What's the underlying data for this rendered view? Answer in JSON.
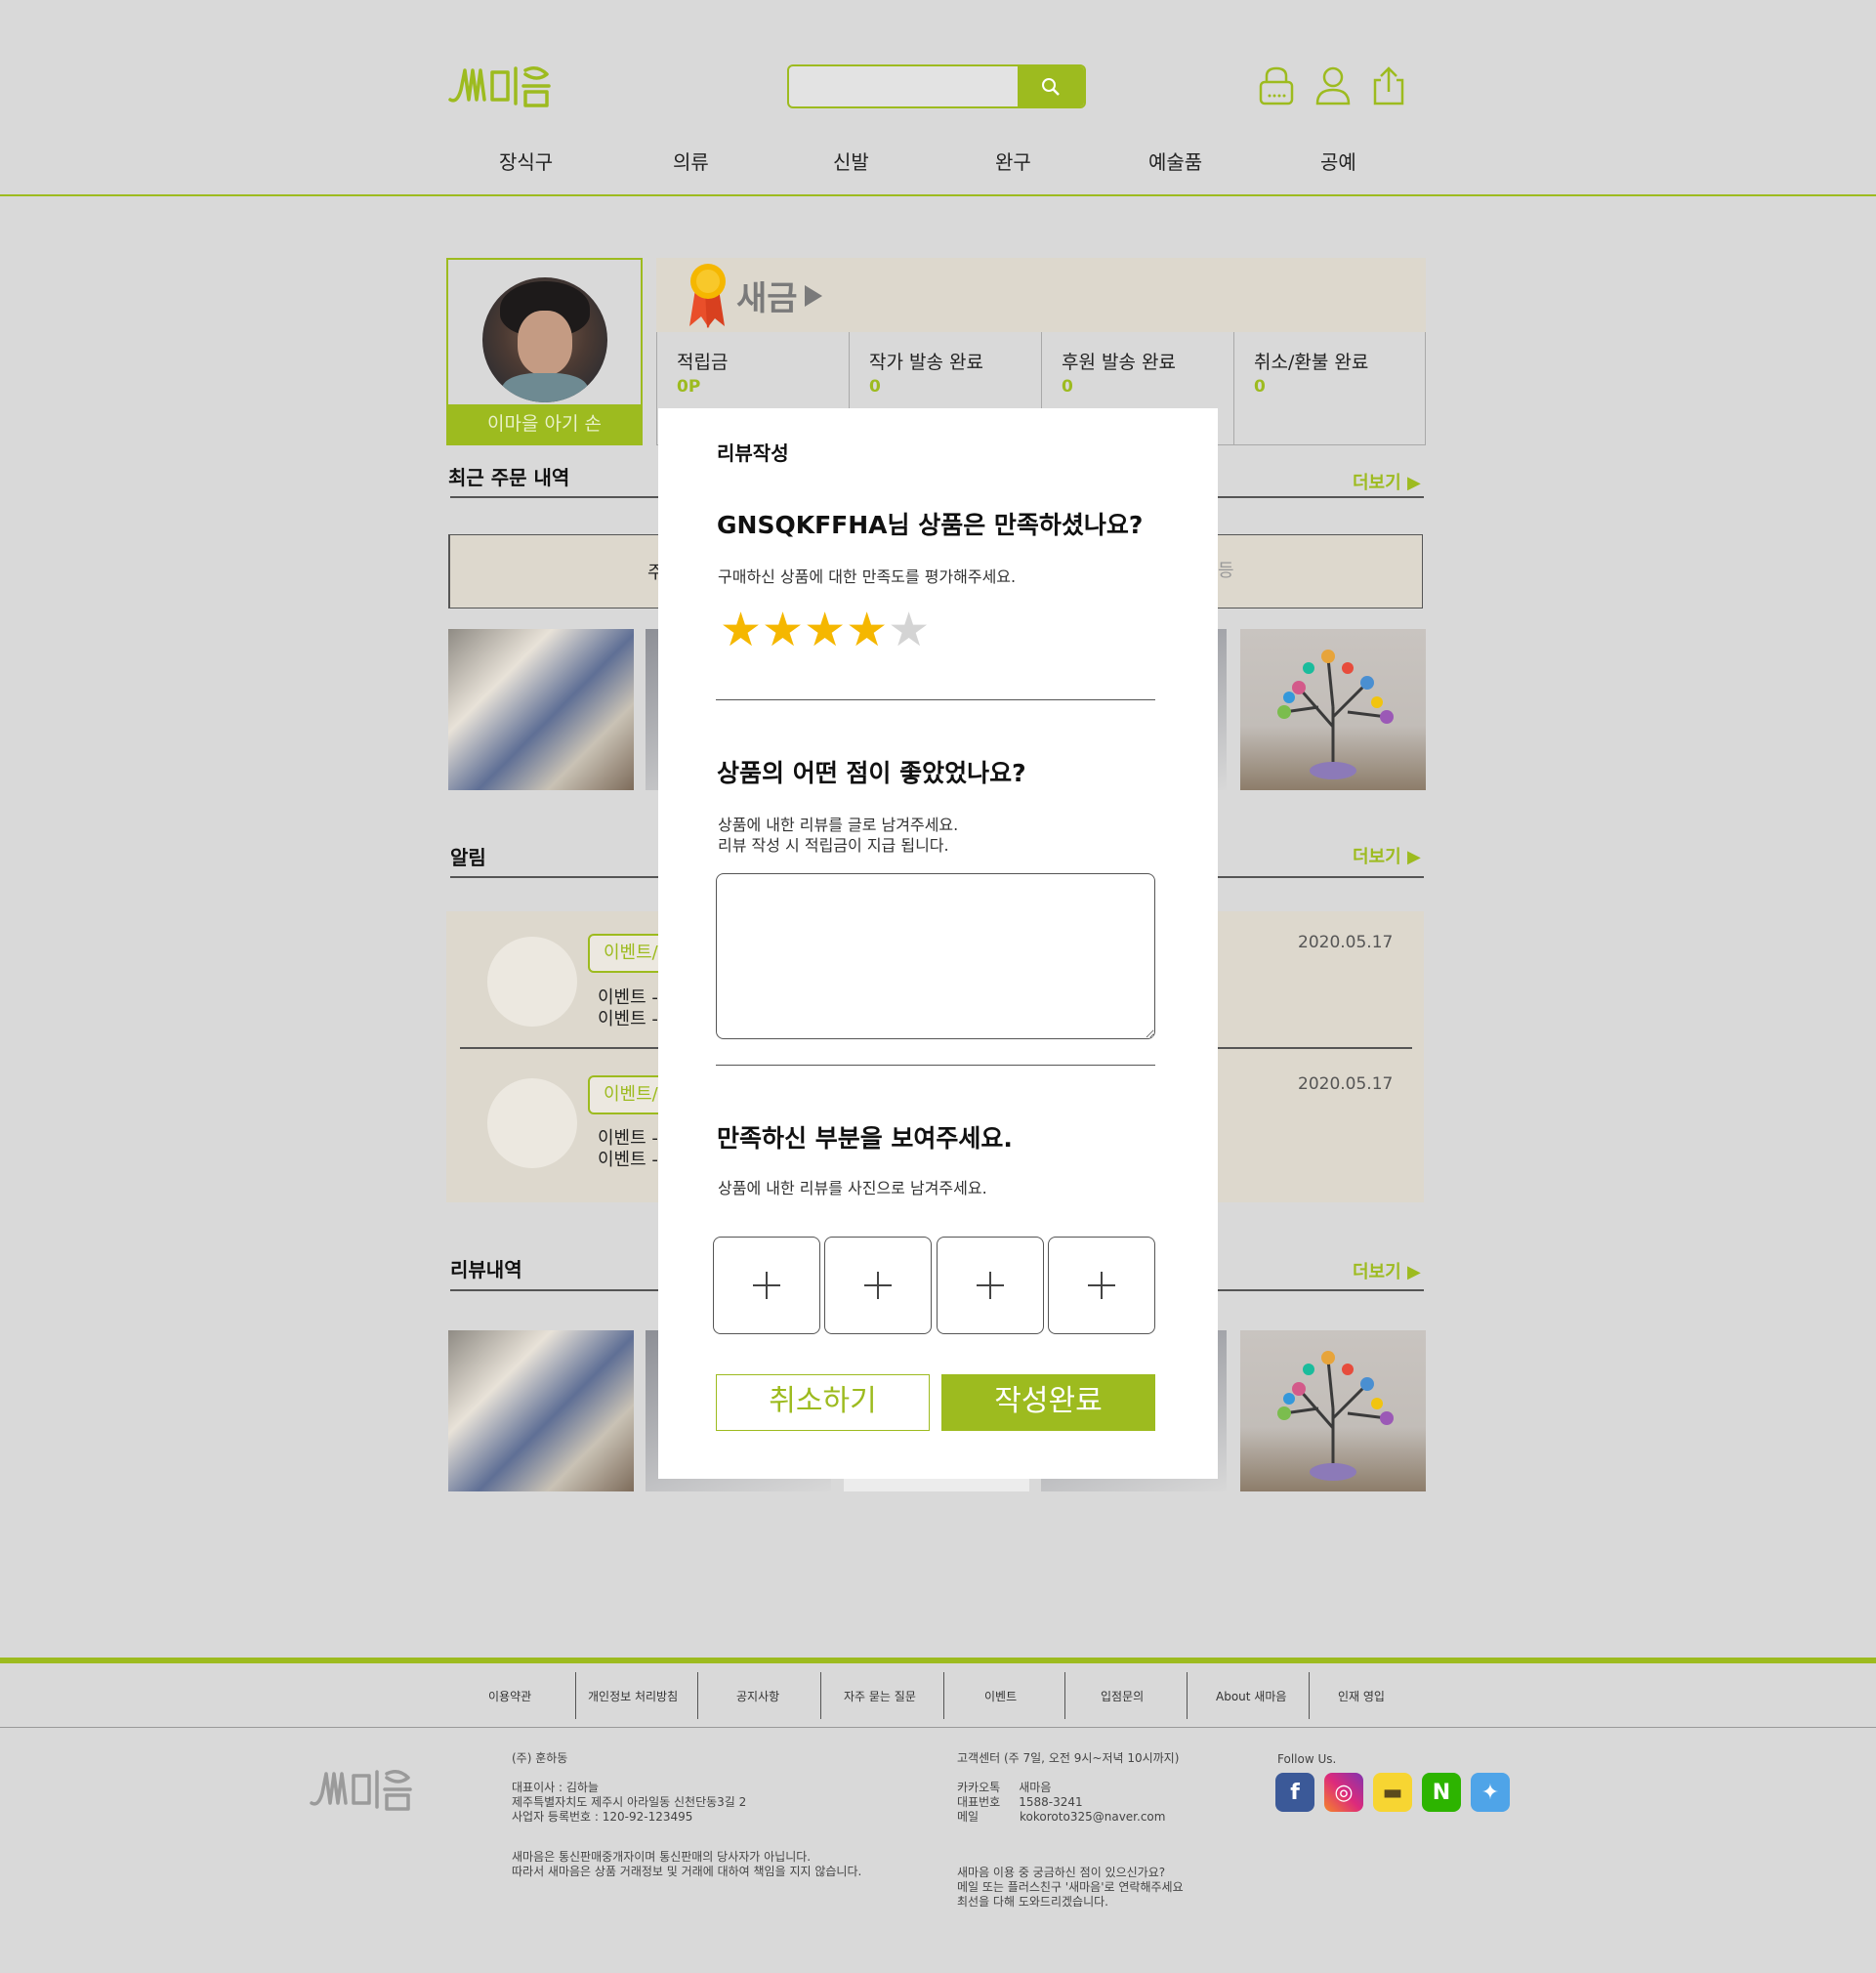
{
  "header": {
    "logo_text": "새마음",
    "search": {
      "placeholder": ""
    },
    "icons": [
      "lock-icon",
      "user-icon",
      "share-icon"
    ],
    "nav": [
      "장식구",
      "의류",
      "신발",
      "완구",
      "예술품",
      "공예"
    ]
  },
  "profile": {
    "name": "이마을 아기 손",
    "grade": "새금",
    "stats": [
      {
        "label": "적립금",
        "value": "0P"
      },
      {
        "label": "작가 발송 완료",
        "value": "0"
      },
      {
        "label": "후원 발송 완료",
        "value": "0"
      },
      {
        "label": "취소/환불 완료",
        "value": "0"
      }
    ]
  },
  "sections": {
    "recent_orders": {
      "title": "최근 주문 내역",
      "more": "더보기",
      "tab_partial_left": "주",
      "tab_partial_right": "등"
    },
    "notices": {
      "title": "알림",
      "more": "더보기",
      "items": [
        {
          "tag": "이벤트/",
          "line1": "이벤트 -",
          "line2": "이벤트 -",
          "date": "2020.05.17"
        },
        {
          "tag": "이벤트/",
          "line1": "이벤트 -",
          "line2": "이벤트 -",
          "date": "2020.05.17"
        }
      ]
    },
    "reviews": {
      "title": "리뷰내역",
      "more": "더보기"
    }
  },
  "modal": {
    "title": "리뷰작성",
    "q1": "GNSQKFFHA님 상품은 만족하셨나요?",
    "q1_desc": "구매하신 상품에 대한 만족도를 평가해주세요.",
    "rating": 4,
    "rating_max": 5,
    "q2": "상품의 어떤 점이 좋았었나요?",
    "q2_desc1": "상품에 내한 리뷰를 글로 남겨주세요.",
    "q2_desc2": "리뷰 작성 시 적립금이 지급 됩니다.",
    "textarea_placeholder": "",
    "q3": "만족하신 부분을 보여주세요.",
    "q3_desc": "상품에 내한 리뷰를 사진으로 남겨주세요.",
    "photo_slots": 4,
    "cancel_label": "취소하기",
    "submit_label": "작성완료"
  },
  "footer": {
    "links": [
      "이용약관",
      "개인정보 처리방침",
      "공지사항",
      "자주 묻는 질문",
      "이벤트",
      "입점문의",
      "About 새마음",
      "인재 영입"
    ],
    "company": "(주) 훈하동",
    "info": "대표이사 : 김하늘\n제주특별자치도 제주시 아라일동 신천단동3길 2\n사업자 등록번호 : 120-92-123495",
    "disclaimer": "새마음은 통신판매중개자이며 통신판매의 당사자가 아닙니다.\n따라서 새마음은 상품 거래정보 및 거래에 대하여 책임을 지지 않습니다.",
    "cs_title": "고객센터 (주 7일, 오전 9시~저녁 10시까지)",
    "cs_info": "카카오톡     새마음\n대표번호     1588-3241\n메일           kokoroto325@naver.com",
    "cs_note": "새마음 이용 중 궁금하신 점이 있으신가요?\n메일 또는 플러스친구 '새마음'로 연락해주세요\n최선을 다해 도와드리겠습니다.",
    "follow": "Follow Us.",
    "social": [
      "facebook-icon",
      "instagram-icon",
      "kakao-icon",
      "naver-icon",
      "twitter-icon"
    ],
    "social_glyphs": [
      "f",
      "◎",
      "▬",
      "N",
      "✦"
    ]
  },
  "colors": {
    "accent": "#9dbb1f",
    "background": "#d9d9d9",
    "panel": "#ddd8cd"
  }
}
